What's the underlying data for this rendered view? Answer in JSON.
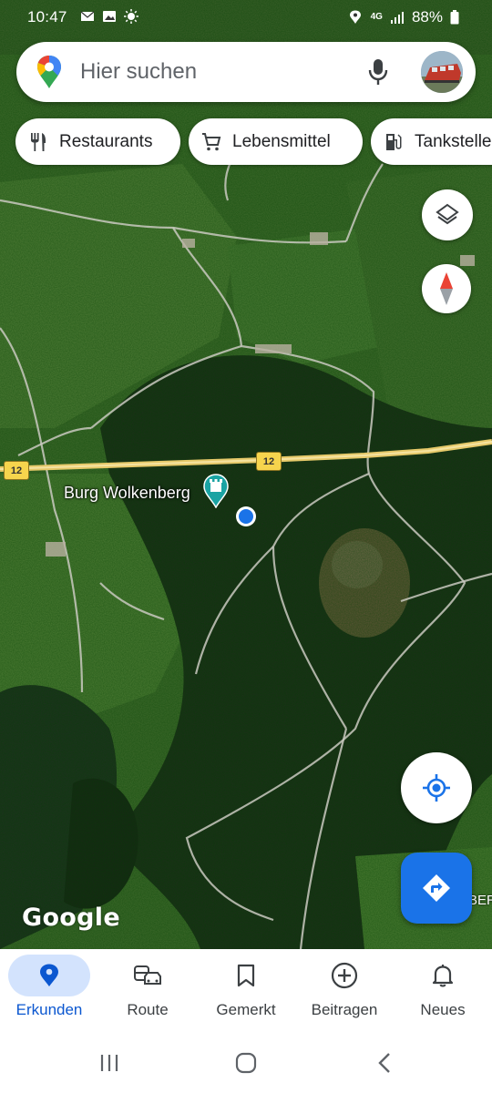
{
  "status_bar": {
    "time": "10:47",
    "network": "4G",
    "battery": "88%"
  },
  "search": {
    "placeholder": "Hier suchen"
  },
  "chips": [
    {
      "label": "Restaurants",
      "icon": "restaurant-icon"
    },
    {
      "label": "Lebensmittel",
      "icon": "grocery-cart-icon"
    },
    {
      "label": "Tankstelle",
      "icon": "gas-station-icon"
    }
  ],
  "map": {
    "place_label": "Burg Wolkenberg",
    "place_icon": "castle-icon",
    "road_number_1": "12",
    "road_number_2": "12",
    "edge_label": "BER",
    "attribution": "Google"
  },
  "bottom_nav": [
    {
      "label": "Erkunden",
      "icon": "explore-pin-icon",
      "active": true
    },
    {
      "label": "Route",
      "icon": "commute-icon",
      "active": false
    },
    {
      "label": "Gemerkt",
      "icon": "bookmark-icon",
      "active": false
    },
    {
      "label": "Beitragen",
      "icon": "add-circle-icon",
      "active": false
    },
    {
      "label": "Neues",
      "icon": "bell-icon",
      "active": false
    }
  ],
  "colors": {
    "accent": "#1a73e8",
    "active_pill": "#d3e3fd",
    "active_text": "#0b57d0"
  }
}
